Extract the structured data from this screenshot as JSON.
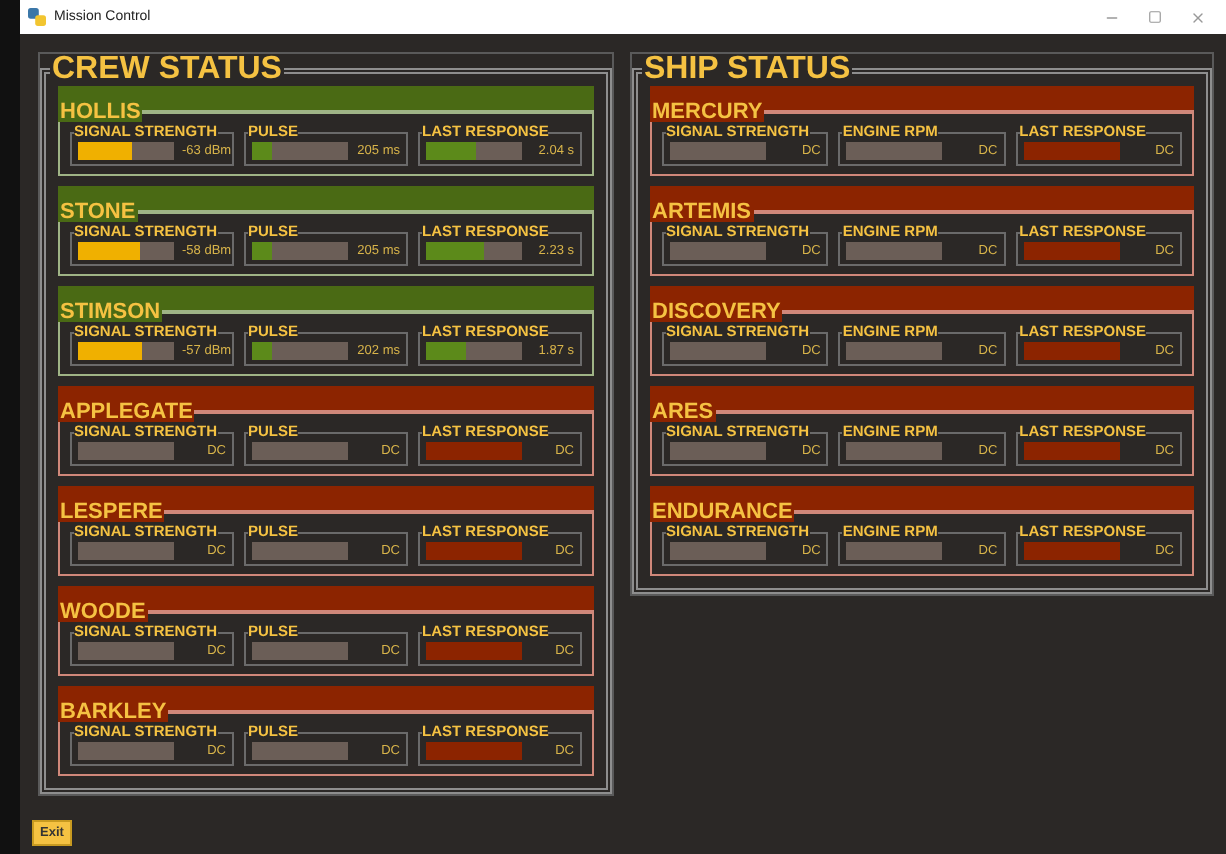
{
  "window": {
    "title": "Mission Control"
  },
  "panels": [
    {
      "title": "CREW STATUS",
      "units": [
        {
          "name": "HOLLIS",
          "connected": true,
          "meters": [
            {
              "kind": "signal",
              "label": "SIGNAL STRENGTH",
              "level": 0.57,
              "reading": "-63 dBm"
            },
            {
              "kind": "pulse",
              "label": "PULSE",
              "level": 0.2,
              "reading": "205 ms"
            },
            {
              "kind": "response",
              "label": "LAST RESPONSE",
              "level": 0.52,
              "reading": "2.04 s"
            }
          ]
        },
        {
          "name": "STONE",
          "connected": true,
          "meters": [
            {
              "kind": "signal",
              "label": "SIGNAL STRENGTH",
              "level": 0.65,
              "reading": "-58 dBm"
            },
            {
              "kind": "pulse",
              "label": "PULSE",
              "level": 0.2,
              "reading": "205 ms"
            },
            {
              "kind": "response",
              "label": "LAST RESPONSE",
              "level": 0.6,
              "reading": "2.23 s"
            }
          ]
        },
        {
          "name": "STIMSON",
          "connected": true,
          "meters": [
            {
              "kind": "signal",
              "label": "SIGNAL STRENGTH",
              "level": 0.66,
              "reading": "-57 dBm"
            },
            {
              "kind": "pulse",
              "label": "PULSE",
              "level": 0.2,
              "reading": "202 ms"
            },
            {
              "kind": "response",
              "label": "LAST RESPONSE",
              "level": 0.42,
              "reading": "1.87 s"
            }
          ]
        },
        {
          "name": "APPLEGATE",
          "connected": false,
          "meters": [
            {
              "kind": "signal",
              "label": "SIGNAL STRENGTH",
              "reading": "DC"
            },
            {
              "kind": "pulse",
              "label": "PULSE",
              "reading": "DC"
            },
            {
              "kind": "response",
              "label": "LAST RESPONSE",
              "reading": "DC"
            }
          ]
        },
        {
          "name": "LESPERE",
          "connected": false,
          "meters": [
            {
              "kind": "signal",
              "label": "SIGNAL STRENGTH",
              "reading": "DC"
            },
            {
              "kind": "pulse",
              "label": "PULSE",
              "reading": "DC"
            },
            {
              "kind": "response",
              "label": "LAST RESPONSE",
              "reading": "DC"
            }
          ]
        },
        {
          "name": "WOODE",
          "connected": false,
          "meters": [
            {
              "kind": "signal",
              "label": "SIGNAL STRENGTH",
              "reading": "DC"
            },
            {
              "kind": "pulse",
              "label": "PULSE",
              "reading": "DC"
            },
            {
              "kind": "response",
              "label": "LAST RESPONSE",
              "reading": "DC"
            }
          ]
        },
        {
          "name": "BARKLEY",
          "connected": false,
          "meters": [
            {
              "kind": "signal",
              "label": "SIGNAL STRENGTH",
              "reading": "DC"
            },
            {
              "kind": "pulse",
              "label": "PULSE",
              "reading": "DC"
            },
            {
              "kind": "response",
              "label": "LAST RESPONSE",
              "reading": "DC"
            }
          ]
        }
      ]
    },
    {
      "title": "SHIP STATUS",
      "units": [
        {
          "name": "MERCURY",
          "connected": false,
          "meters": [
            {
              "kind": "signal",
              "label": "SIGNAL STRENGTH",
              "reading": "DC"
            },
            {
              "kind": "pulse",
              "label": "ENGINE RPM",
              "reading": "DC"
            },
            {
              "kind": "response",
              "label": "LAST RESPONSE",
              "reading": "DC"
            }
          ]
        },
        {
          "name": "ARTEMIS",
          "connected": false,
          "meters": [
            {
              "kind": "signal",
              "label": "SIGNAL STRENGTH",
              "reading": "DC"
            },
            {
              "kind": "pulse",
              "label": "ENGINE RPM",
              "reading": "DC"
            },
            {
              "kind": "response",
              "label": "LAST RESPONSE",
              "reading": "DC"
            }
          ]
        },
        {
          "name": "DISCOVERY",
          "connected": false,
          "meters": [
            {
              "kind": "signal",
              "label": "SIGNAL STRENGTH",
              "reading": "DC"
            },
            {
              "kind": "pulse",
              "label": "ENGINE RPM",
              "reading": "DC"
            },
            {
              "kind": "response",
              "label": "LAST RESPONSE",
              "reading": "DC"
            }
          ]
        },
        {
          "name": "ARES",
          "connected": false,
          "meters": [
            {
              "kind": "signal",
              "label": "SIGNAL STRENGTH",
              "reading": "DC"
            },
            {
              "kind": "pulse",
              "label": "ENGINE RPM",
              "reading": "DC"
            },
            {
              "kind": "response",
              "label": "LAST RESPONSE",
              "reading": "DC"
            }
          ]
        },
        {
          "name": "ENDURANCE",
          "connected": false,
          "meters": [
            {
              "kind": "signal",
              "label": "SIGNAL STRENGTH",
              "reading": "DC"
            },
            {
              "kind": "pulse",
              "label": "ENGINE RPM",
              "reading": "DC"
            },
            {
              "kind": "response",
              "label": "LAST RESPONSE",
              "reading": "DC"
            }
          ]
        }
      ]
    }
  ],
  "exit_button": "Exit"
}
